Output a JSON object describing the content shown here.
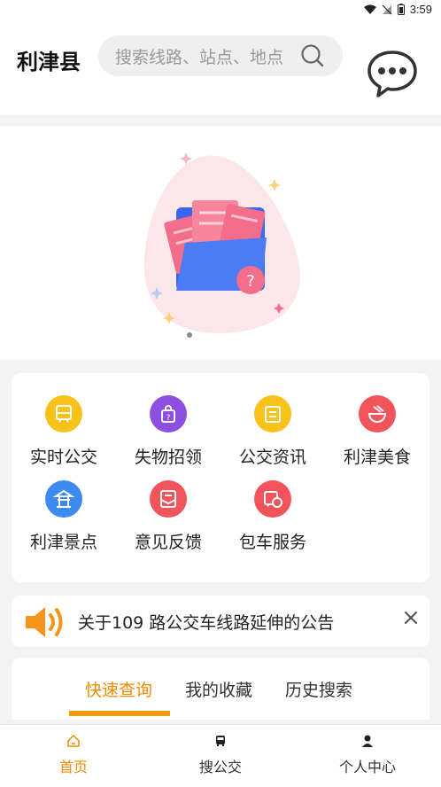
{
  "status_bar": {
    "time": "3:59"
  },
  "header": {
    "city": "利津县",
    "search_placeholder": "搜索线路、站点、地点"
  },
  "grid": [
    {
      "label": "实时公交",
      "color": "#f7c21a"
    },
    {
      "label": "失物招领",
      "color": "#8d4fe0"
    },
    {
      "label": "公交资讯",
      "color": "#f7c21a"
    },
    {
      "label": "利津美食",
      "color": "#f2545b"
    },
    {
      "label": "利津景点",
      "color": "#3d8bf0"
    },
    {
      "label": "意见反馈",
      "color": "#f2545b"
    },
    {
      "label": "包车服务",
      "color": "#f2545b"
    }
  ],
  "notice": {
    "text": "关于109 路公交车线路延伸的公告"
  },
  "tabs": [
    "快速查询",
    "我的收藏",
    "历史搜索"
  ],
  "bottom_nav": [
    "首页",
    "搜公交",
    "个人中心"
  ],
  "colors": {
    "accent": "#f08c00",
    "notice_icon": "#f7941d"
  }
}
